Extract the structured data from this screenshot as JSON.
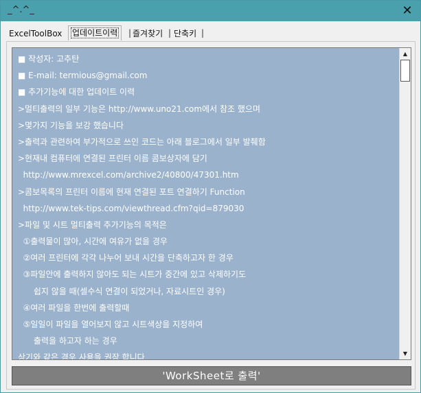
{
  "window": {
    "title": "_^.^_",
    "close_glyph": "✕"
  },
  "tabs": [
    {
      "label": "ExcelToolBox",
      "active": false
    },
    {
      "label": "업데이트이력",
      "active": true
    },
    {
      "label": "즐겨찾기",
      "active": false
    },
    {
      "label": "단축키",
      "active": false
    }
  ],
  "tab_separator": "|",
  "content": {
    "lines": [
      "작성자: 고추탄",
      "E-mail: termious@gmail.com",
      "추가기능에 대한 업데이트 이력",
      ">멀티출력의 일부 기능은 http://www.uno21.com에서 참조 했으며",
      ">몇가지 기능을 보강 했습니다",
      ">출력과 관련하여 부가적으로 쓰인 코드는 아래 블로그에서 일부 발췌함",
      ">현재내 컴퓨터에 연결된 프린터 이름 콤보상자에 담기",
      "  http://www.mrexcel.com/archive2/40800/47301.htm",
      ">콤보목록의 프린터 이름에 현재 연결된 포트 연결하기 Function",
      "  http://www.tek-tips.com/viewthread.cfm?qid=879030",
      ">파일 및 시트 멀티출력 추가기능의 목적은",
      "  ①출력물이 많아, 시간에 여유가 없을 경우",
      "  ②여러 프린터에 각각 나누어 보내 시간을 단축하고자 한 경우",
      "  ③파일안에 출력하지 않아도 되는 시트가 중간에 있고 삭제하기도",
      "      쉽지 않을 때(셀수식 연결이 되었거나, 자료시트인 경우)",
      "  ④여러 파일을 한번에 출력할때",
      "  ⑤일일이 파일을 열어보지 않고 시트색상을 지정하여",
      "      출력을 하고자 하는 경우",
      "상기와 같은 경우 사용을 권장 합니다"
    ]
  },
  "scrollbar": {
    "up_glyph": "▲",
    "down_glyph": "▼",
    "position": 0.0
  },
  "action_button": {
    "label": "'WorkSheet로 출력'"
  },
  "colors": {
    "titlebar": "#4aa0ad",
    "textbox_bg": "#9ab2cc",
    "button_bg": "#7f7f7f"
  }
}
